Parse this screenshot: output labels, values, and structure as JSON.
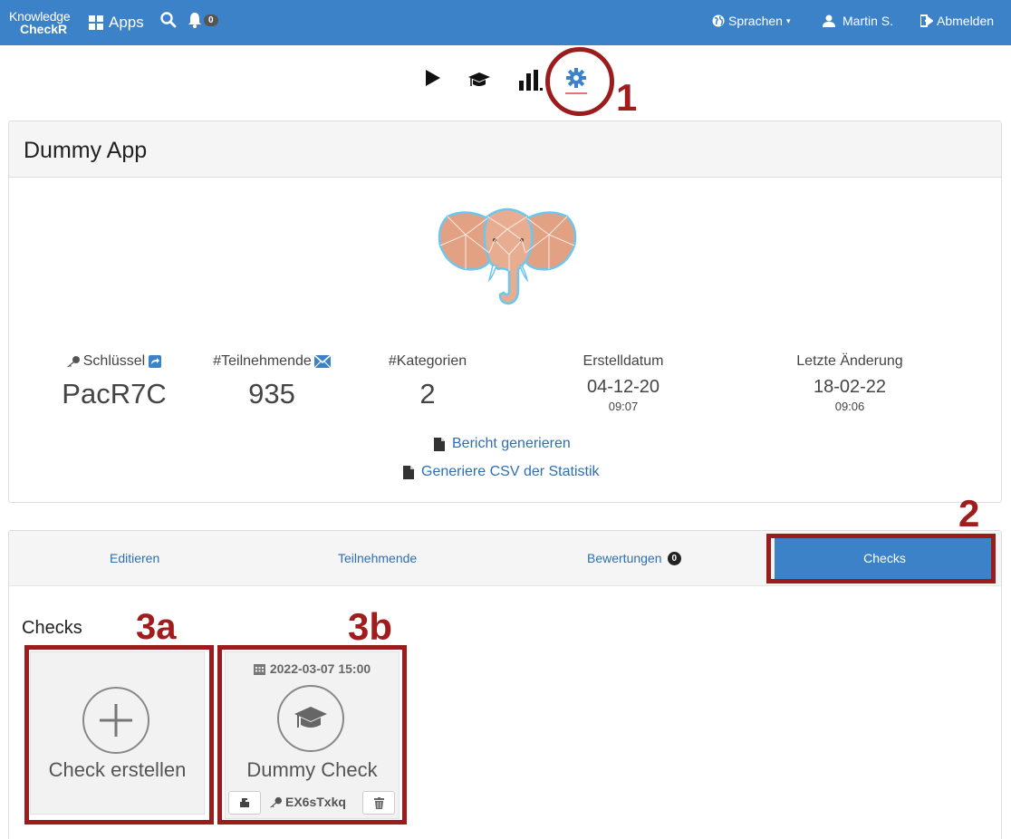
{
  "navbar": {
    "brand_top": "Knowledge",
    "brand_bottom": "CheckR",
    "apps_label": "Apps",
    "notifications_count": "0",
    "language_label": "Sprachen",
    "user_label": "Martin S.",
    "logout_label": "Abmelden",
    "color": "#3b82c8"
  },
  "iconbar": {
    "icons": [
      "play-icon",
      "graduation-cap-icon",
      "bar-chart-icon",
      "gear-icon"
    ],
    "active": "gear-icon"
  },
  "annotations": {
    "n1": "1",
    "n2": "2",
    "n3a": "3a",
    "n3b": "3b",
    "color": "#9b1c1c"
  },
  "app": {
    "title": "Dummy App",
    "stats": {
      "key_label": "Schlüssel",
      "key_value": "PacR7C",
      "participants_label": "#Teilnehmende",
      "participants_value": "935",
      "categories_label": "#Kategorien",
      "categories_value": "2",
      "created_label": "Erstelldatum",
      "created_date": "04-12-20",
      "created_time": "09:07",
      "modified_label": "Letzte Änderung",
      "modified_date": "18-02-22",
      "modified_time": "09:06"
    },
    "report_link": "Bericht generieren",
    "csv_link": "Generiere CSV der Statistik"
  },
  "tabs": {
    "edit": "Editieren",
    "participants": "Teilnehmende",
    "ratings": "Bewertungen",
    "ratings_count": "0",
    "checks": "Checks"
  },
  "checks": {
    "title": "Checks",
    "create_label": "Check erstellen",
    "items": [
      {
        "date": "2022-03-07 15:00",
        "name": "Dummy Check",
        "key": "EX6sTxkq"
      }
    ]
  }
}
